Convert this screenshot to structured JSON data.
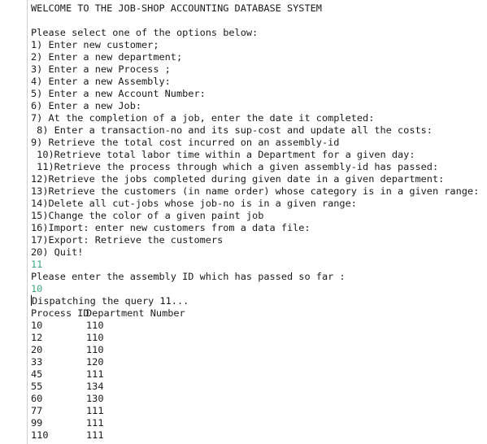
{
  "console": {
    "title": "WELCOME TO THE JOB-SHOP ACCOUNTING DATABASE SYSTEM",
    "prompt": "Please select one of the options below:",
    "options": [
      "1) Enter new customer;",
      "2) Enter a new department;",
      "3) Enter a new Process ;",
      "4) Enter a new Assembly:",
      "5) Enter a new Account Number:",
      "6) Enter a new Job:",
      "7) At the completion of a job, enter the date it completed:",
      " 8) Enter a transaction-no and its sup-cost and update all the costs:",
      "9) Retrieve the total cost incurred on an assembly-id",
      " 10)Retrieve total labor time within a Department for a given day:",
      " 11)Retrieve the process through which a given assembly-id has passed:",
      "12)Retrieve the jobs completed during given date in a given department:",
      "13)Retrieve the customers (in name order) whose category is in a given range:",
      "14)Delete all cut-jobs whose job-no is in a given range:",
      "15)Change the color of a given paint job",
      "16)Import: enter new customers from a data file:",
      "17)Export: Retrieve the customers",
      "20) Quit!"
    ],
    "user_choice": "11",
    "assembly_prompt": "Please enter the assembly ID which has passed so far :",
    "user_assembly_id": "10",
    "dispatch_message": "Dispatching the query 11...",
    "result_header": {
      "process_id": "Process ID",
      "department_number": "Department Number"
    },
    "results": [
      {
        "process_id": "10",
        "department_number": "110"
      },
      {
        "process_id": "12",
        "department_number": "110"
      },
      {
        "process_id": "20",
        "department_number": "110"
      },
      {
        "process_id": "33",
        "department_number": "120"
      },
      {
        "process_id": "45",
        "department_number": "111"
      },
      {
        "process_id": "55",
        "department_number": "134"
      },
      {
        "process_id": "60",
        "department_number": "130"
      },
      {
        "process_id": "77",
        "department_number": "111"
      },
      {
        "process_id": "99",
        "department_number": "111"
      },
      {
        "process_id": "110",
        "department_number": "111"
      }
    ]
  }
}
